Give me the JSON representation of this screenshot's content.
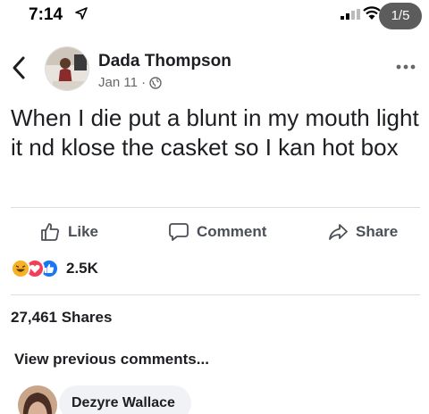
{
  "status_bar": {
    "time": "7:14",
    "page_indicator": "1/5"
  },
  "post": {
    "author": "Dada Thompson",
    "date": "Jan 11 ·",
    "text": "When I die put a blunt in my mouth light it nd klose the casket so I kan hot box"
  },
  "actions": {
    "like": "Like",
    "comment": "Comment",
    "share": "Share"
  },
  "reactions": {
    "count": "2.5K",
    "types": [
      "haha",
      "love",
      "like"
    ]
  },
  "shares": "27,461 Shares",
  "view_previous": "View previous comments...",
  "comment": {
    "author": "Dezyre Wallace"
  },
  "colors": {
    "text": "#1c1e21",
    "meta": "#65676b",
    "like_blue": "#1877f2",
    "love_red": "#f33e58",
    "haha_yellow": "#f7b125",
    "bubble": "#f0f2f5"
  },
  "icons": [
    "location-arrow-icon",
    "signal-icon",
    "wifi-icon",
    "back-chevron-icon",
    "globe-icon",
    "more-icon",
    "like-icon",
    "comment-icon",
    "share-icon"
  ]
}
